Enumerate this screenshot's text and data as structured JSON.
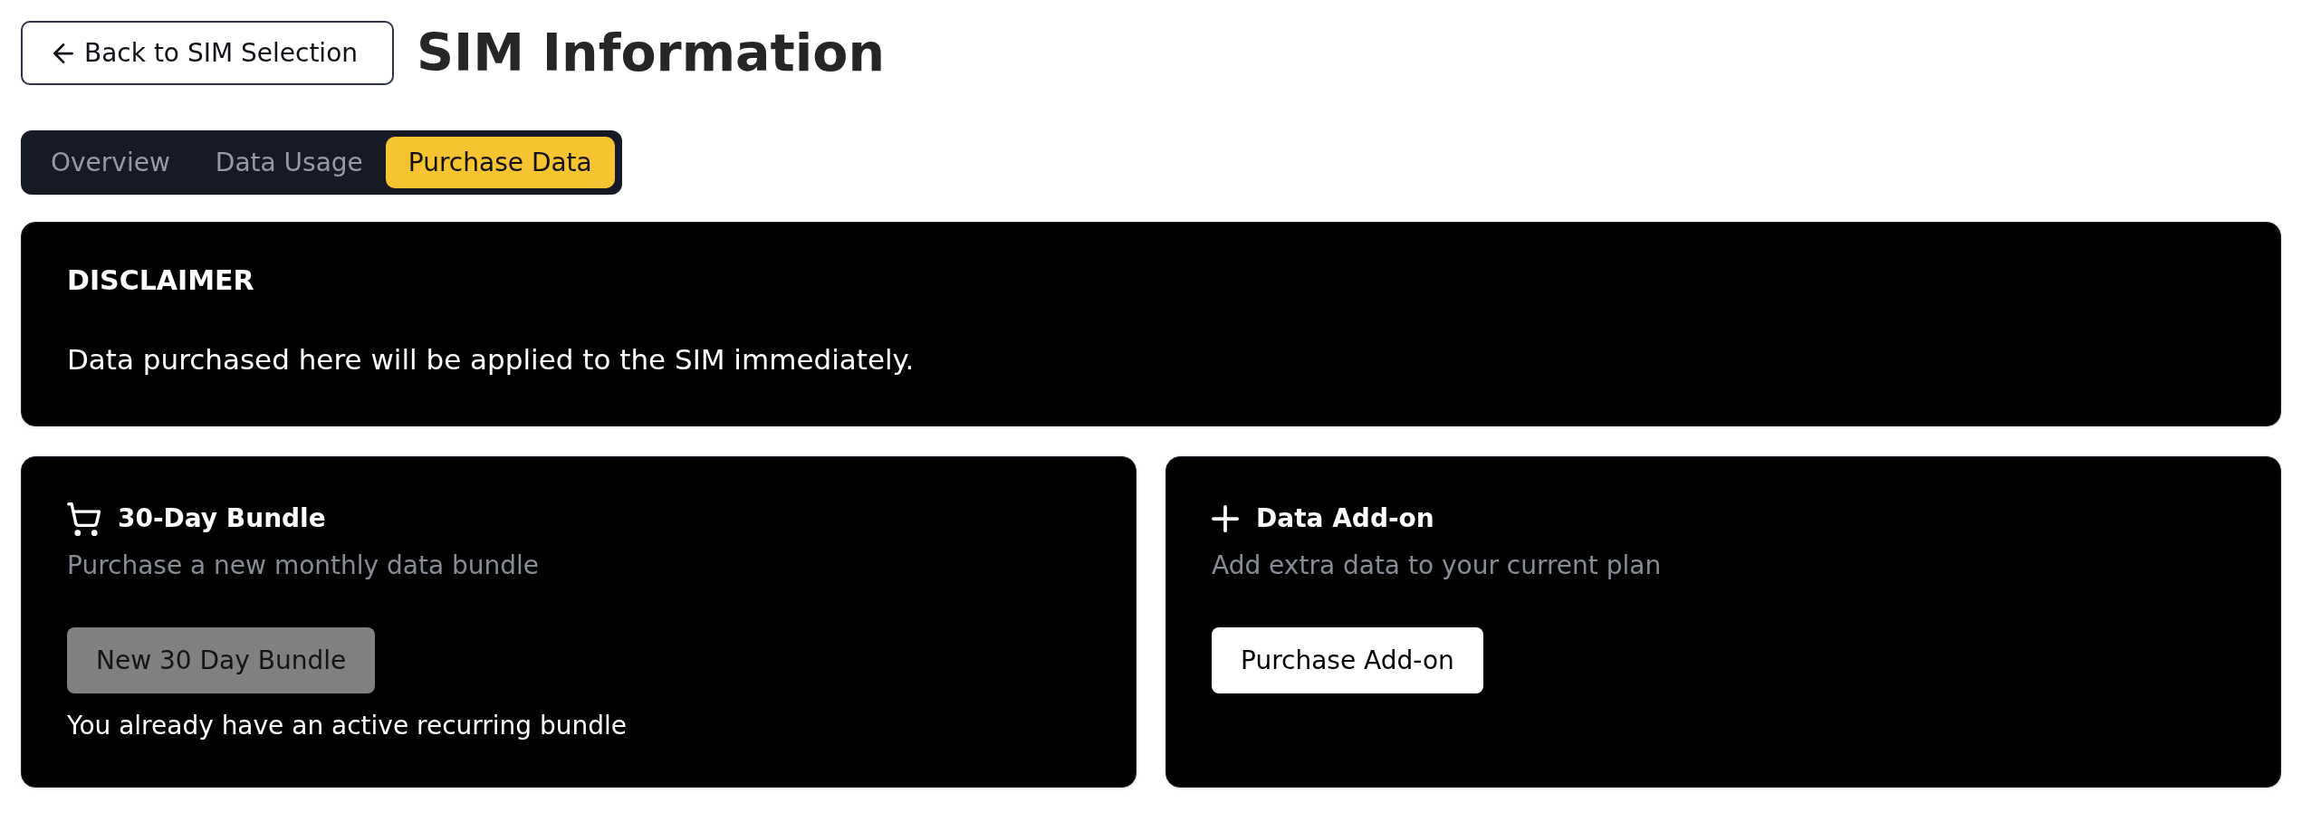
{
  "header": {
    "back_button": "Back to SIM Selection",
    "title": "SIM Information"
  },
  "tabs": [
    {
      "label": "Overview",
      "selected": false
    },
    {
      "label": "Data Usage",
      "selected": false
    },
    {
      "label": "Purchase Data",
      "selected": true
    }
  ],
  "disclaimer": {
    "title": "DISCLAIMER",
    "text": "Data purchased here will be applied to the SIM immediately."
  },
  "cards": [
    {
      "kind": "bundle",
      "title": "30-Day Bundle",
      "subtitle": "Purchase a new monthly data bundle",
      "button": {
        "label": "New 30 Day Bundle",
        "disabled": true
      },
      "note": "You already have an active recurring bundle"
    },
    {
      "kind": "addon",
      "title": "Data Add-on",
      "subtitle": "Add extra data to your current plan",
      "button": {
        "label": "Purchase Add-on",
        "disabled": false
      }
    }
  ]
}
